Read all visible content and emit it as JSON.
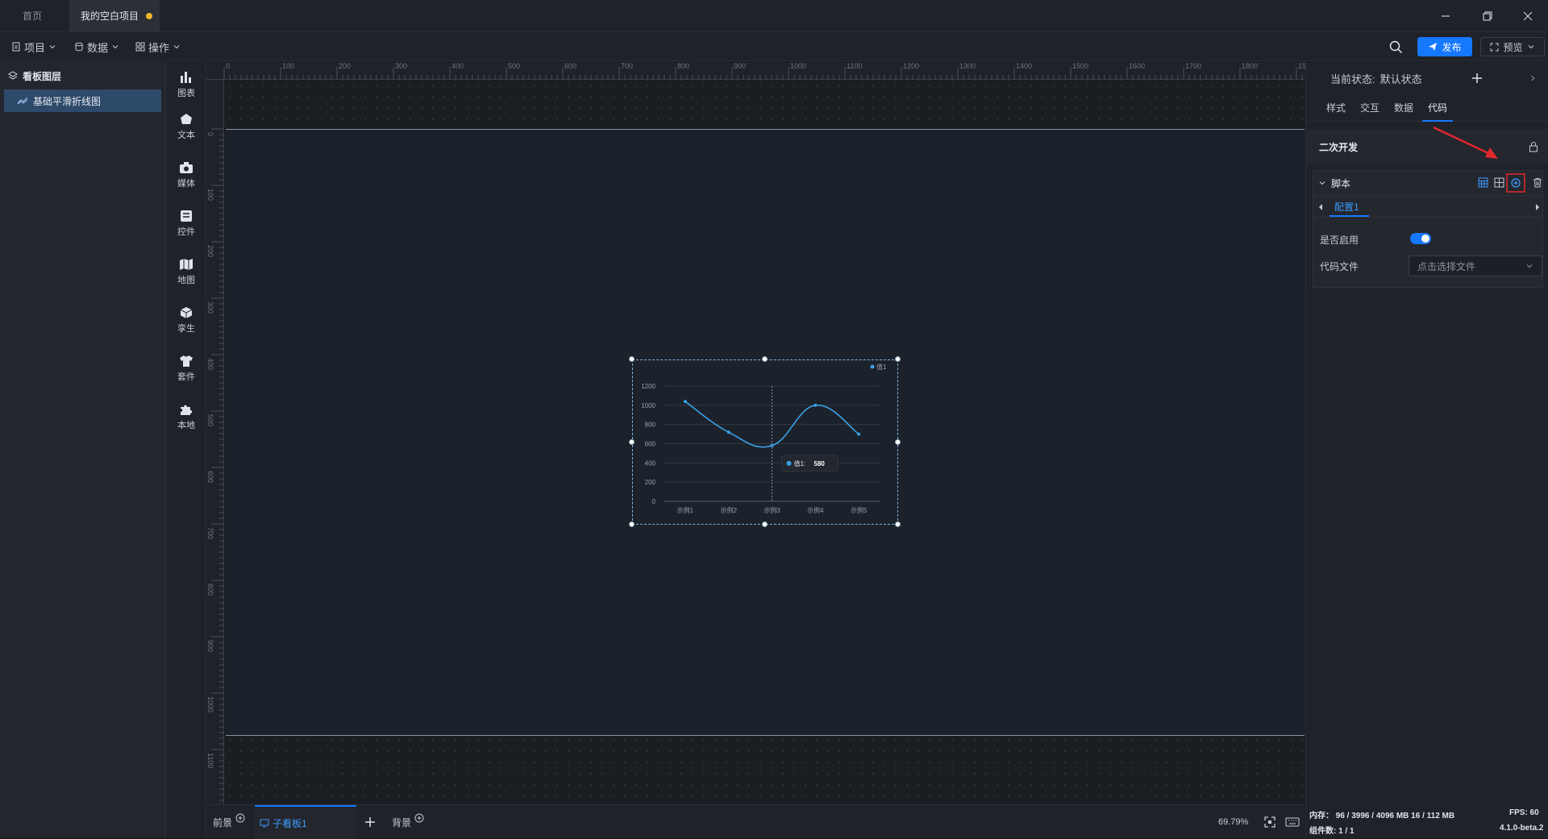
{
  "titlebar": {
    "tabs": [
      {
        "label": "首页"
      },
      {
        "label": "我的空白项目"
      }
    ]
  },
  "toolbar": {
    "menus": [
      {
        "label": "项目"
      },
      {
        "label": "数据"
      },
      {
        "label": "操作"
      }
    ],
    "publish_label": "发布",
    "preview_label": "预览"
  },
  "layers": {
    "title": "看板图层",
    "items": [
      {
        "label": "基础平滑折线图"
      }
    ]
  },
  "sidebar": {
    "categories": [
      {
        "label": "图表"
      },
      {
        "label": "文本"
      },
      {
        "label": "媒体"
      },
      {
        "label": "控件"
      },
      {
        "label": "地图"
      },
      {
        "label": "孪生"
      },
      {
        "label": "套件"
      },
      {
        "label": "本地"
      }
    ]
  },
  "ruler": {
    "top_ticks": [
      "0",
      "100",
      "200",
      "300",
      "400",
      "500",
      "600",
      "700",
      "800",
      "900",
      "1000",
      "1100",
      "1200",
      "1300",
      "1400",
      "1500",
      "1600",
      "1700",
      "1800",
      "1900"
    ],
    "left_ticks": [
      "0",
      "100",
      "200",
      "300",
      "400",
      "500",
      "600",
      "700",
      "800",
      "900",
      "1000",
      "1100",
      "1200"
    ]
  },
  "chart_data": {
    "type": "line",
    "smooth": true,
    "categories": [
      "示例1",
      "示例2",
      "示例3",
      "示例4",
      "示例5"
    ],
    "series": [
      {
        "name": "值1",
        "values": [
          1040,
          720,
          580,
          1000,
          700
        ],
        "color": "#3aa0e8"
      }
    ],
    "ylim": [
      0,
      1200
    ],
    "yticks": [
      "0",
      "200",
      "400",
      "600",
      "800",
      "1000",
      "1200"
    ],
    "legend": "top-right",
    "tooltip": {
      "label": "值1:",
      "value": "580"
    }
  },
  "bottombar": {
    "foreground_label": "前景",
    "board_label": "子看板1",
    "background_label": "背景",
    "zoom": "69.79%"
  },
  "rightpanel": {
    "state_label": "当前状态:",
    "state_value": "默认状态",
    "tabs": [
      {
        "label": "样式"
      },
      {
        "label": "交互"
      },
      {
        "label": "数据"
      },
      {
        "label": "代码"
      }
    ],
    "secondary_title": "二次开发",
    "script_title": "脚本",
    "config_tab": "配置1",
    "enabled_label": "是否启用",
    "code_file_label": "代码文件",
    "code_file_placeholder": "点击选择文件"
  },
  "statusbar": {
    "memory": "内存：  96 / 3996 / 4096 MB  16 / 112 MB",
    "fps": "FPS:   60",
    "components": "组件数: 1 / 1",
    "version": "4.1.0-beta.2"
  },
  "colors": {
    "accent": "#1677ff",
    "highlight_red": "#e0282e",
    "unsaved_dot": "#f0b429"
  }
}
